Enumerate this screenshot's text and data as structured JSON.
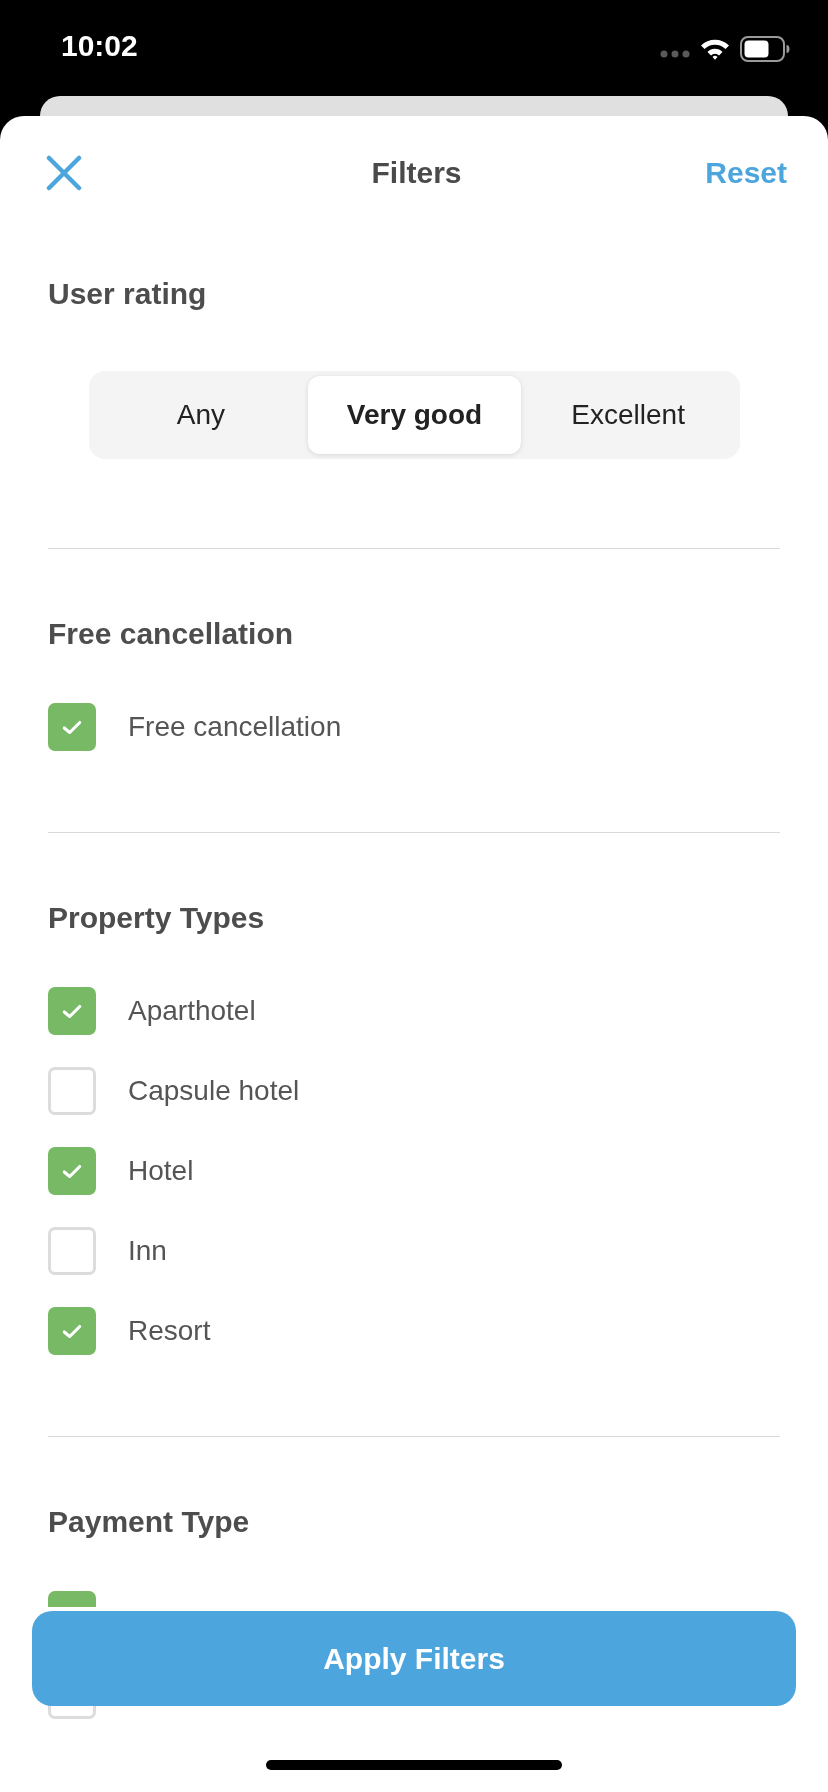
{
  "status_bar": {
    "time": "10:02"
  },
  "header": {
    "title": "Filters",
    "reset": "Reset"
  },
  "sections": [
    {
      "kind": "segmented",
      "title": "User rating",
      "options": [
        {
          "label": "Any",
          "selected": false
        },
        {
          "label": "Very good",
          "selected": true
        },
        {
          "label": "Excellent",
          "selected": false
        }
      ]
    },
    {
      "kind": "checklist",
      "title": "Free cancellation",
      "items": [
        {
          "label": "Free cancellation",
          "checked": true
        }
      ]
    },
    {
      "kind": "checklist",
      "title": "Property Types",
      "items": [
        {
          "label": "Aparthotel",
          "checked": true
        },
        {
          "label": "Capsule hotel",
          "checked": false
        },
        {
          "label": "Hotel",
          "checked": true
        },
        {
          "label": "Inn",
          "checked": false
        },
        {
          "label": "Resort",
          "checked": true
        }
      ]
    },
    {
      "kind": "checklist",
      "title": "Payment Type",
      "items": [
        {
          "checked": true
        },
        {
          "checked": false
        }
      ]
    }
  ],
  "apply_button": {
    "label": "Apply Filters"
  }
}
